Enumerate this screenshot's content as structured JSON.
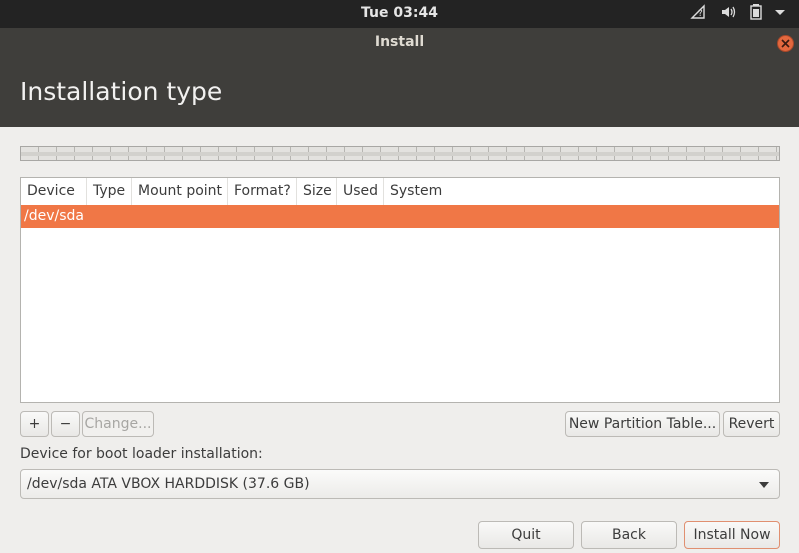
{
  "topbar": {
    "clock": "Tue 03:44"
  },
  "window": {
    "title": "Install"
  },
  "header": {
    "title": "Installation type"
  },
  "table": {
    "columns": [
      "Device",
      "Type",
      "Mount point",
      "Format?",
      "Size",
      "Used",
      "System"
    ],
    "rows": [
      {
        "device": "/dev/sda"
      }
    ]
  },
  "buttons": {
    "add": "+",
    "remove": "−",
    "change": "Change...",
    "new_partition_table": "New Partition Table...",
    "revert": "Revert",
    "quit": "Quit",
    "back": "Back",
    "install_now": "Install Now"
  },
  "bootloader": {
    "label": "Device for boot loader installation:",
    "selected": "/dev/sda ATA VBOX HARDDISK (37.6 GB)"
  },
  "colors": {
    "accent": "#f07746",
    "header_bg": "#3f3e3b",
    "topbar_bg": "#232323"
  }
}
